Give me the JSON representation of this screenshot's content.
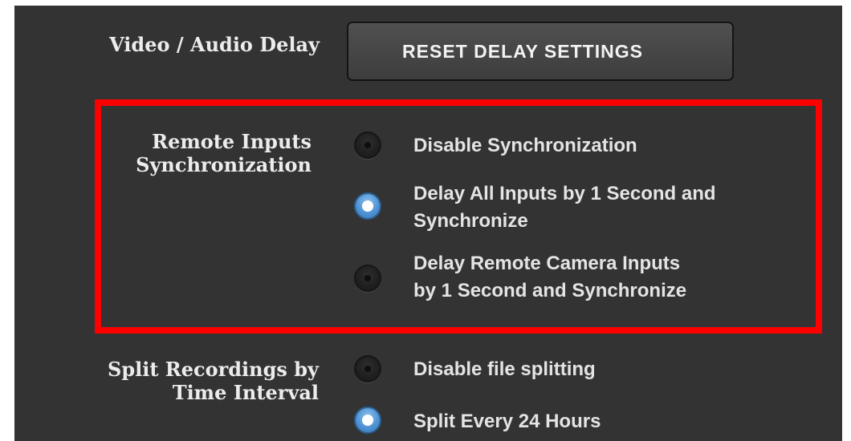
{
  "colors": {
    "panel_background": "#333333",
    "text": "#e4e4e4",
    "highlight_border": "#ff0000",
    "radio_selected": "#4f93d4"
  },
  "video_audio_delay": {
    "label": "Video / Audio Delay",
    "reset_button": "RESET DELAY SETTINGS"
  },
  "remote_inputs_sync": {
    "label_line1": "Remote Inputs",
    "label_line2": "Synchronization",
    "options": [
      {
        "line1": "Disable Synchronization",
        "line2": "",
        "selected": false
      },
      {
        "line1": "Delay All Inputs by 1 Second and",
        "line2": "Synchronize",
        "selected": true
      },
      {
        "line1": "Delay Remote Camera Inputs",
        "line2": "by 1 Second and Synchronize",
        "selected": false
      }
    ]
  },
  "split_recordings": {
    "label_line1": "Split Recordings by",
    "label_line2": "Time Interval",
    "options": [
      {
        "line1": "Disable file splitting",
        "selected": false
      },
      {
        "line1": "Split Every 24 Hours",
        "selected": true
      }
    ]
  }
}
